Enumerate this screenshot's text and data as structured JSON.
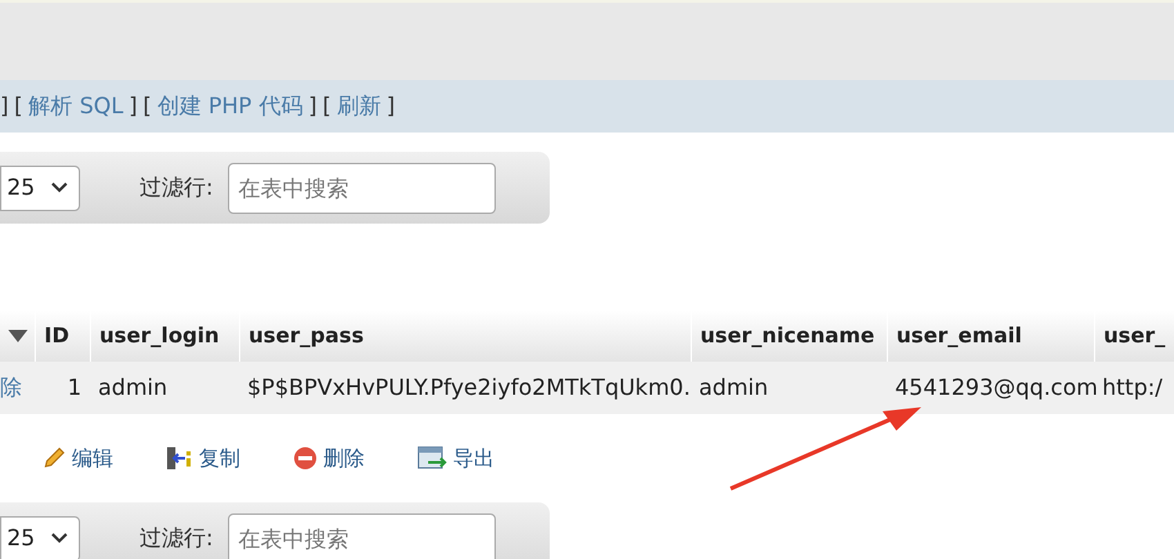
{
  "query_links": {
    "leading": "]",
    "items": [
      {
        "open": "[",
        "label": "解析 SQL",
        "close": "]"
      },
      {
        "open": "[",
        "label": "创建 PHP 代码",
        "close": "]"
      },
      {
        "open": "[",
        "label": "刷新",
        "close": "]"
      }
    ]
  },
  "top_controls": {
    "page_size": "25",
    "filter_label": "过滤行:",
    "filter_placeholder": "在表中搜索"
  },
  "table": {
    "columns": [
      "ID",
      "user_login",
      "user_pass",
      "user_nicename",
      "user_email",
      "user_"
    ],
    "rows": [
      {
        "action": "除",
        "cells": [
          "1",
          "admin",
          "$P$BPVxHvPULY.Pfye2iyfo2MTkTqUkm0.",
          "admin",
          "4541293@qq.com",
          "http:/"
        ]
      }
    ]
  },
  "bulk_actions": [
    {
      "kind": "edit",
      "label": "编辑"
    },
    {
      "kind": "copy",
      "label": "复制"
    },
    {
      "kind": "delete",
      "label": "删除"
    },
    {
      "kind": "export",
      "label": "导出"
    }
  ],
  "bottom_controls": {
    "page_size": "25",
    "filter_label": "过滤行:",
    "filter_placeholder": "在表中搜索"
  }
}
